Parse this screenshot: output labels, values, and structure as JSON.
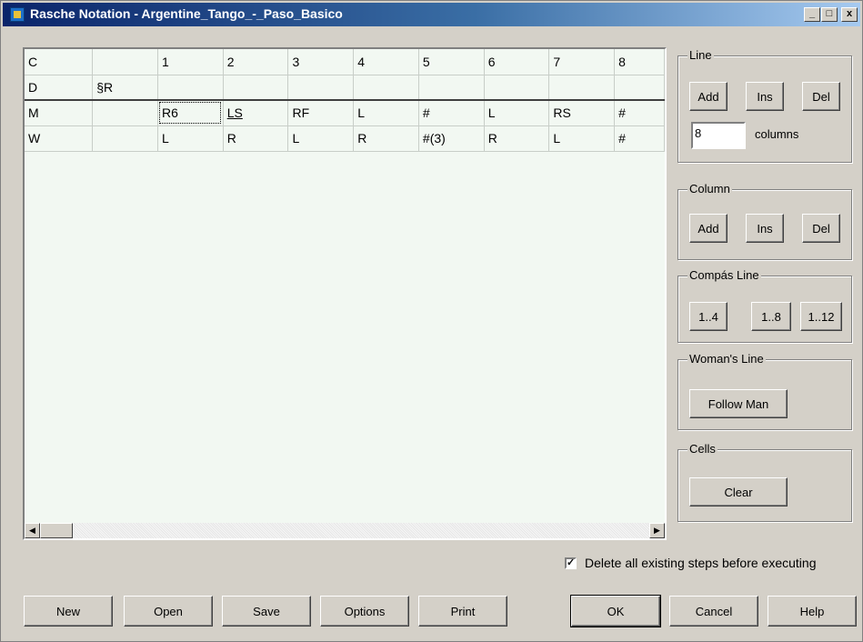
{
  "window": {
    "title": "Rasche Notation - Argentine_Tango_-_Paso_Basico",
    "min_glyph": "_",
    "max_glyph": "□",
    "close_glyph": "x"
  },
  "grid": {
    "rows": [
      [
        "C",
        "",
        "1",
        "2",
        "3",
        "4",
        "5",
        "6",
        "7",
        "8"
      ],
      [
        "D",
        "§R",
        "",
        "",
        "",
        "",
        "",
        "",
        "",
        ""
      ],
      [
        "M",
        "",
        "R6",
        "LS",
        "RF",
        "L",
        "#",
        "L",
        "RS",
        "#"
      ],
      [
        "W",
        "",
        "L",
        "R",
        "L",
        "R",
        "#(3)",
        "R",
        "L",
        "#"
      ]
    ]
  },
  "scrollbar": {
    "left_glyph": "◀",
    "right_glyph": "▶"
  },
  "line_group": {
    "label": "Line",
    "add": "Add",
    "ins": "Ins",
    "del": "Del",
    "columns_value": "8",
    "columns_label": "columns"
  },
  "column_group": {
    "label": "Column",
    "add": "Add",
    "ins": "Ins",
    "del": "Del"
  },
  "compas_group": {
    "label": "Compás Line",
    "b4": "1..4",
    "b8": "1..8",
    "b12": "1..12"
  },
  "woman_group": {
    "label": "Woman's Line",
    "follow": "Follow Man"
  },
  "cells_group": {
    "label": "Cells",
    "clear": "Clear"
  },
  "delete_option": {
    "checked": true,
    "check_glyph": "✓",
    "label": "Delete all existing steps before executing"
  },
  "bottom_buttons": {
    "new": "New",
    "open": "Open",
    "save": "Save",
    "options": "Options",
    "print": "Print",
    "ok": "OK",
    "cancel": "Cancel",
    "help": "Help"
  }
}
